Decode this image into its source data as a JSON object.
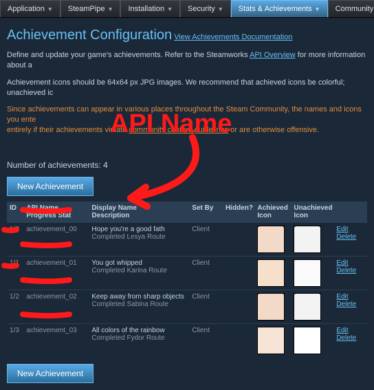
{
  "tabs": [
    {
      "label": "Application"
    },
    {
      "label": "SteamPipe"
    },
    {
      "label": "Installation"
    },
    {
      "label": "Security"
    },
    {
      "label": "Stats & Achievements",
      "active": true
    },
    {
      "label": "Community"
    }
  ],
  "page_title": "Achievement Configuration",
  "doc_link": "View Achievements Documentation",
  "para1_a": "Define and update your game's achievements. Refer to the Steamworks ",
  "para1_link": "API Overview",
  "para1_b": " for more information about a",
  "para2": "Achievement icons should be 64x64 px JPG images. We recommend that achieved icons be colorful; unachieved ic",
  "warn_a": "Since achievements can appear in various places throughout the Steam Community, the names and icons you ente",
  "warn_b": "entirely if their achievements violate ",
  "warn_link": "community content guidelines",
  "warn_c": " or are otherwise offensive.",
  "count_label": "Number of achievements: ",
  "count_value": "4",
  "new_btn": "New Achievement",
  "headers": {
    "id": "ID",
    "api_a": "API Name",
    "api_b": "Progress Stat",
    "disp_a": "Display Name",
    "disp_b": "Description",
    "setby": "Set By",
    "hidden": "Hidden?",
    "ach_a": "Achieved",
    "ach_b": "Icon",
    "un_a": "Unachieved",
    "un_b": "Icon"
  },
  "rows": [
    {
      "id": "1/0",
      "api": "achievement_00",
      "disp": "Hope you're a good fath",
      "desc": "Completed Lesya Route",
      "setby": "Client"
    },
    {
      "id": "1/1",
      "api": "achievement_01",
      "disp": "You got whipped",
      "desc": "Completed Karina Route",
      "setby": "Client"
    },
    {
      "id": "1/2",
      "api": "achievement_02",
      "disp": "Keep away from sharp objects",
      "desc": "Completed Sabina Route",
      "setby": "Client"
    },
    {
      "id": "1/3",
      "api": "achievement_03",
      "disp": "All colors of the rainbow",
      "desc": "Completed Fydor Route",
      "setby": "Client"
    }
  ],
  "edit_label": "Edit",
  "delete_label": "Delete",
  "annotation_text": "API Name"
}
